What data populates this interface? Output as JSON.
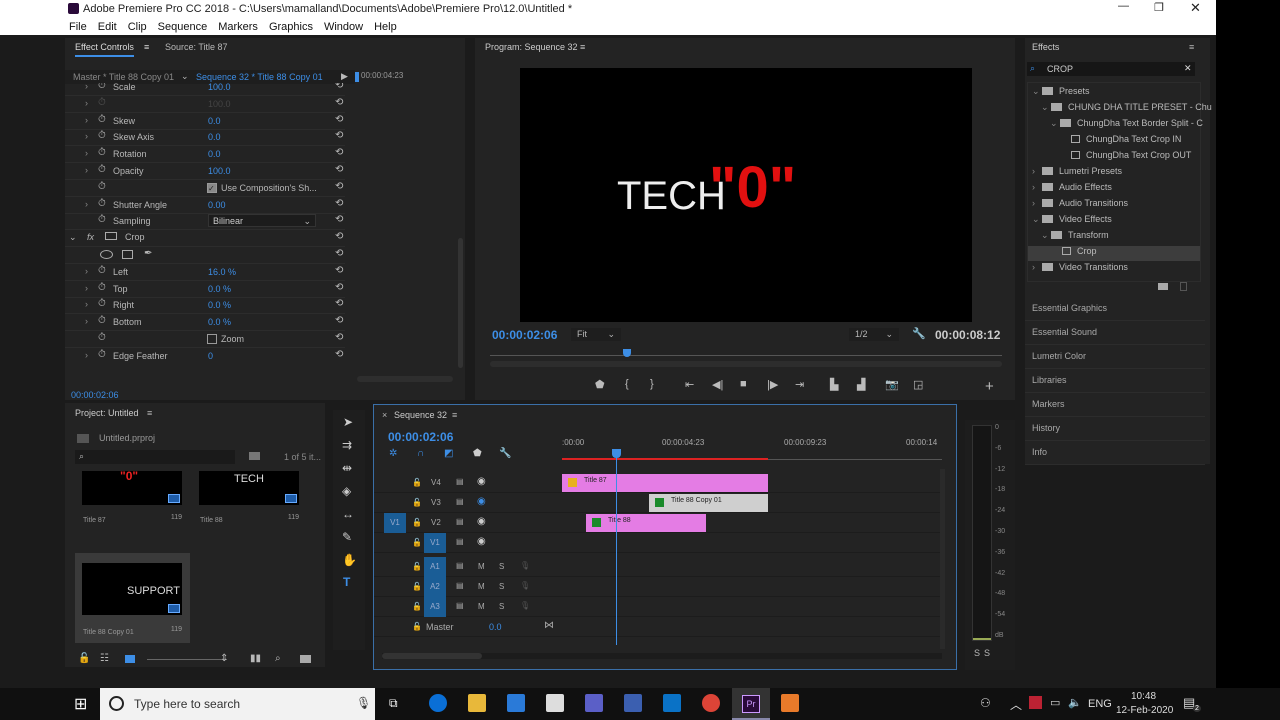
{
  "window": {
    "title": "Adobe Premiere Pro CC 2018 - C:\\Users\\mamalland\\Documents\\Adobe\\Premiere Pro\\12.0\\Untitled *",
    "menus": [
      "File",
      "Edit",
      "Clip",
      "Sequence",
      "Markers",
      "Graphics",
      "Window",
      "Help"
    ]
  },
  "effect_controls": {
    "tab": "Effect Controls",
    "tab2": "Source: Title 87",
    "master": "Master * Title 88 Copy 01",
    "sequence": "Sequence 32 * Title 88 Copy 01",
    "mini_time": "00:00:04:23",
    "timecode": "00:00:02:06",
    "rows": [
      {
        "label": "Scale",
        "value": "100.0"
      },
      {
        "label": "",
        "value": "100.0",
        "dim": true
      },
      {
        "label": "Skew",
        "value": "0.0"
      },
      {
        "label": "Skew Axis",
        "value": "0.0"
      },
      {
        "label": "Rotation",
        "value": "0.0"
      },
      {
        "label": "Opacity",
        "value": "100.0"
      },
      {
        "label": "",
        "value": "Use Composition's Sh...",
        "checkbox": true,
        "checked": true
      },
      {
        "label": "Shutter Angle",
        "value": "0.00"
      },
      {
        "label": "Sampling",
        "value": "Bilinear",
        "dropdown": true
      },
      {
        "label": "Crop",
        "fx": true
      },
      {
        "label": "",
        "masks": true
      },
      {
        "label": "Left",
        "value": "16.0 %"
      },
      {
        "label": "Top",
        "value": "0.0 %"
      },
      {
        "label": "Right",
        "value": "0.0 %"
      },
      {
        "label": "Bottom",
        "value": "0.0 %"
      },
      {
        "label": "",
        "value": "Zoom",
        "checkbox": true,
        "checked": false
      },
      {
        "label": "Edge Feather",
        "value": "0"
      }
    ]
  },
  "program": {
    "title": "Program: Sequence 32",
    "timecode": "00:00:02:06",
    "fit": "Fit",
    "resolution": "1/2",
    "duration": "00:00:08:12",
    "video_text_white": "TECH",
    "video_text_red": "\"0\"",
    "playhead_fraction": 0.26
  },
  "effects": {
    "title": "Effects",
    "search": "CROP",
    "tree": [
      {
        "label": "Presets",
        "level": 0,
        "open": true
      },
      {
        "label": "CHUNG DHA TITLE PRESET - Chu",
        "level": 1,
        "open": true
      },
      {
        "label": "ChungDha Text Border Split  - C",
        "level": 2,
        "open": true
      },
      {
        "label": "ChungDha Text Crop IN",
        "level": 3,
        "preset": true
      },
      {
        "label": "ChungDha Text Crop OUT",
        "level": 3,
        "preset": true
      },
      {
        "label": "Lumetri Presets",
        "level": 0
      },
      {
        "label": "Audio Effects",
        "level": 0
      },
      {
        "label": "Audio Transitions",
        "level": 0
      },
      {
        "label": "Video Effects",
        "level": 0,
        "open": true
      },
      {
        "label": "Transform",
        "level": 1,
        "open": true
      },
      {
        "label": "Crop",
        "level": 2,
        "effect": true,
        "selected": true
      },
      {
        "label": "Video Transitions",
        "level": 0
      }
    ],
    "collapsed_panels": [
      "Essential Graphics",
      "Essential Sound",
      "Lumetri Color",
      "Libraries",
      "Markers",
      "History",
      "Info"
    ]
  },
  "project": {
    "title": "Project: Untitled",
    "file": "Untitled.prproj",
    "count": "1 of 5 it...",
    "items": [
      {
        "name": "Title 87",
        "dur": "119",
        "thumb": "\"0\"",
        "red": true
      },
      {
        "name": "Title 88",
        "dur": "119",
        "thumb": "TECH"
      },
      {
        "name": "Title 88 Copy 01",
        "dur": "119",
        "thumb": "SUPPORT",
        "selected": true
      }
    ]
  },
  "timeline": {
    "title": "Sequence 32",
    "timecode": "00:00:02:06",
    "ruler": [
      ":00:00",
      "00:00:04:23",
      "00:00:09:23",
      "00:00:14"
    ],
    "video_tracks": [
      {
        "name": "V4",
        "eye": "on"
      },
      {
        "name": "V3",
        "eye": "off"
      },
      {
        "name": "V2",
        "eye": "on",
        "source": "V1"
      },
      {
        "name": "V1",
        "eye": "on",
        "target": true
      }
    ],
    "audio_tracks": [
      "A1",
      "A2",
      "A3"
    ],
    "master": "Master",
    "master_value": "0.0",
    "clips": [
      {
        "name": "Title 87",
        "track": "V4",
        "color": "#e47ce4",
        "fx_color": "#e8b020"
      },
      {
        "name": "Title 88 Copy 01",
        "track": "V3",
        "color": "#cfcfcf",
        "fx_color": "#1a8a2a"
      },
      {
        "name": "Title 88",
        "track": "V2",
        "color": "#e47ce4",
        "fx_color": "#1a8a2a"
      }
    ]
  },
  "meter": {
    "scale": [
      "0",
      "-6",
      "-12",
      "-18",
      "-24",
      "-30",
      "-36",
      "-42",
      "-48",
      "-54",
      "dB"
    ],
    "solo": [
      "S",
      "S"
    ]
  },
  "taskbar": {
    "search": "Type here to search",
    "lang": "ENG",
    "time": "10:48",
    "date": "12-Feb-2020",
    "notifications": "2"
  }
}
